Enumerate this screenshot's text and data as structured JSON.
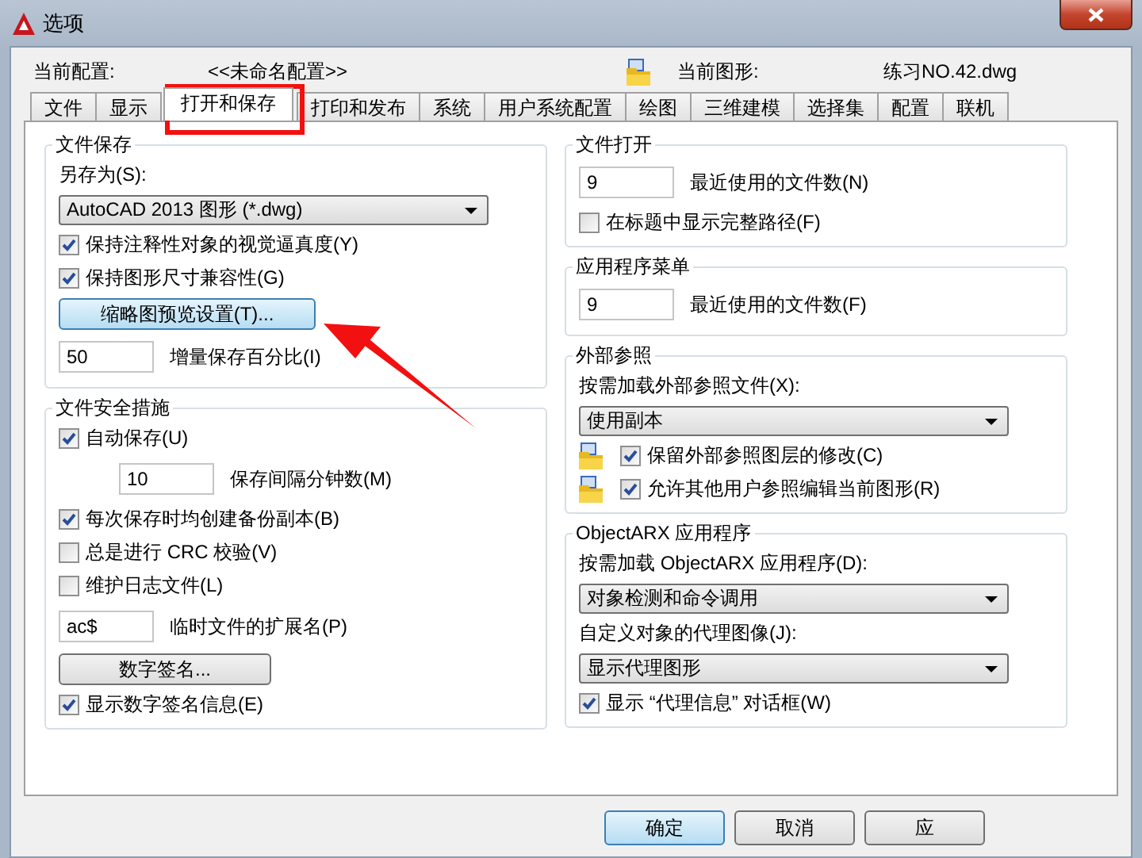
{
  "window": {
    "title": "选项"
  },
  "header": {
    "profile_label": "当前配置:",
    "profile_value": "<<未命名配置>>",
    "drawing_label": "当前图形:",
    "drawing_value": "练习NO.42.dwg"
  },
  "tabs": [
    {
      "label": "文件",
      "selected": false
    },
    {
      "label": "显示",
      "selected": false
    },
    {
      "label": "打开和保存",
      "selected": true
    },
    {
      "label": "打印和发布",
      "selected": false
    },
    {
      "label": "系统",
      "selected": false
    },
    {
      "label": "用户系统配置",
      "selected": false
    },
    {
      "label": "绘图",
      "selected": false
    },
    {
      "label": "三维建模",
      "selected": false
    },
    {
      "label": "选择集",
      "selected": false
    },
    {
      "label": "配置",
      "selected": false
    },
    {
      "label": "联机",
      "selected": false
    }
  ],
  "left_groups": [
    {
      "title": "文件保存",
      "items": [
        {
          "kind": "label",
          "text": "另存为(S):"
        },
        {
          "kind": "dropdown",
          "value": "AutoCAD 2013 图形 (*.dwg)"
        },
        {
          "kind": "checkbox",
          "label": "保持注释性对象的视觉逼真度(Y)",
          "checked": true
        },
        {
          "kind": "checkbox",
          "label": "保持图形尺寸兼容性(G)",
          "checked": true
        },
        {
          "kind": "button",
          "label": "缩略图预览设置(T)...",
          "focused": true
        },
        {
          "kind": "input",
          "value": "50",
          "text": "增量保存百分比(I)"
        }
      ]
    },
    {
      "title": "文件安全措施",
      "items": [
        {
          "kind": "checkbox",
          "label": "自动保存(U)",
          "checked": true
        },
        {
          "kind": "sub_input",
          "value": "10",
          "text": "保存间隔分钟数(M)"
        },
        {
          "kind": "checkbox",
          "label": "每次保存时均创建备份副本(B)",
          "checked": true
        },
        {
          "kind": "checkbox",
          "label": "总是进行 CRC 校验(V)",
          "checked": false
        },
        {
          "kind": "checkbox",
          "label": "维护日志文件(L)",
          "checked": false
        },
        {
          "kind": "input",
          "value": "ac$",
          "text": "临时文件的扩展名(P)"
        },
        {
          "kind": "button",
          "label": "数字签名...",
          "focused": false
        },
        {
          "kind": "checkbox",
          "label": "显示数字签名信息(E)",
          "checked": true
        }
      ]
    }
  ],
  "right_groups": [
    {
      "title": "文件打开",
      "items": [
        {
          "kind": "input",
          "value": "9",
          "text": "最近使用的文件数(N)"
        },
        {
          "kind": "checkbox",
          "label": "在标题中显示完整路径(F)",
          "checked": false
        }
      ]
    },
    {
      "title": "应用程序菜单",
      "items": [
        {
          "kind": "input",
          "value": "9",
          "text": "最近使用的文件数(F)"
        }
      ]
    },
    {
      "title": "外部参照",
      "items": [
        {
          "kind": "label",
          "text": "按需加载外部参照文件(X):"
        },
        {
          "kind": "dropdown",
          "value": "使用副本"
        },
        {
          "kind": "icon_checkbox",
          "label": "保留外部参照图层的修改(C)",
          "checked": true
        },
        {
          "kind": "icon_checkbox",
          "label": "允许其他用户参照编辑当前图形(R)",
          "checked": true
        }
      ]
    },
    {
      "title": "ObjectARX 应用程序",
      "items": [
        {
          "kind": "label",
          "text": "按需加载 ObjectARX 应用程序(D):"
        },
        {
          "kind": "dropdown",
          "value": "对象检测和命令调用"
        },
        {
          "kind": "label",
          "text": "自定义对象的代理图像(J):"
        },
        {
          "kind": "dropdown",
          "value": "显示代理图形"
        },
        {
          "kind": "checkbox",
          "label": "显示 “代理信息” 对话框(W)",
          "checked": true
        }
      ]
    }
  ],
  "buttons": [
    {
      "label": "确定",
      "focused": true
    },
    {
      "label": "取消",
      "focused": false
    },
    {
      "label": "应",
      "focused": false
    }
  ]
}
